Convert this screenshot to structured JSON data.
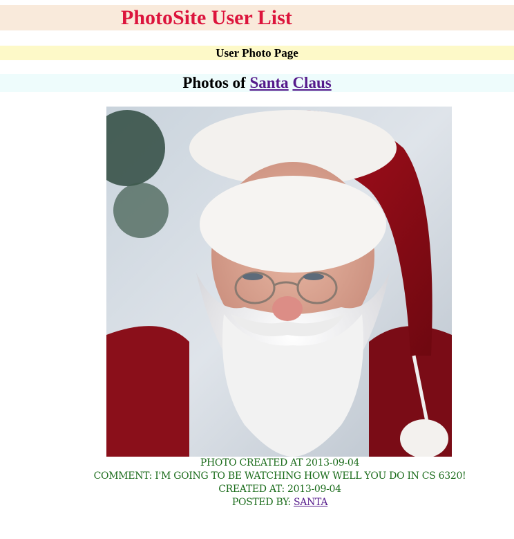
{
  "header": {
    "site_title": "PhotoSite User List",
    "page_subtitle": "User Photo Page"
  },
  "photos_heading": {
    "prefix": "Photos of",
    "first_name": "Santa",
    "last_name": "Claus"
  },
  "photo": {
    "subject": "photo of Santa Claus"
  },
  "photo_details": {
    "created_label": "Photo created at",
    "created_date": "2013-09-04",
    "comment_label": "Comment:",
    "comment_text": "I'm going to be watching how well you do in CS 6320!",
    "comment_created_label": "Created at:",
    "comment_created_date": "2013-09-04",
    "posted_by_label": "Posted by:",
    "posted_by_user": "Santa"
  },
  "colors": {
    "title": "#dc143c",
    "title_band": "#f9eadb",
    "subtitle_band": "#fdf9c8",
    "heading_band": "#eefcfc",
    "caption_text": "#1a6b1a",
    "link": "#551a8b"
  }
}
